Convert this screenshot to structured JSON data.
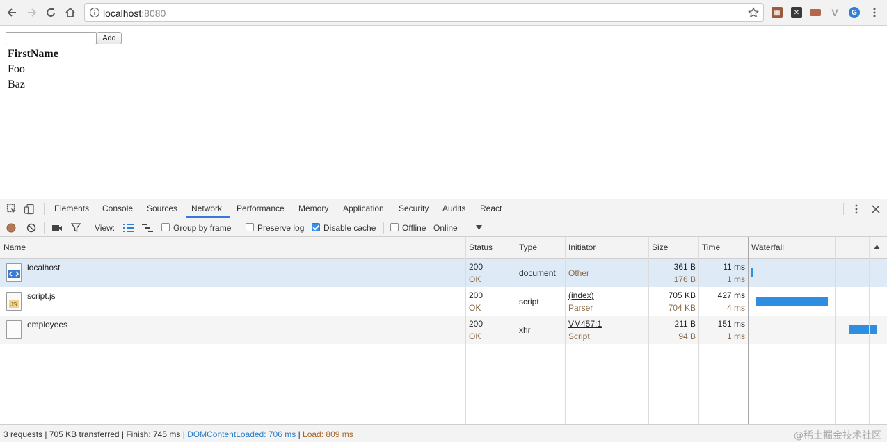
{
  "browser": {
    "url_host": "localhost",
    "url_port": ":8080"
  },
  "page": {
    "add_button": "Add",
    "input_value": "",
    "table_header": "FirstName",
    "rows": [
      "Foo",
      "Baz"
    ]
  },
  "devtools": {
    "tabs": [
      "Elements",
      "Console",
      "Sources",
      "Network",
      "Performance",
      "Memory",
      "Application",
      "Security",
      "Audits",
      "React"
    ],
    "active_tab": "Network",
    "toolbar": {
      "view_label": "View:",
      "group_by_frame": "Group by frame",
      "preserve_log": "Preserve log",
      "disable_cache": "Disable cache",
      "offline": "Offline",
      "throttle": "Online"
    },
    "columns": {
      "name": "Name",
      "status": "Status",
      "type": "Type",
      "initiator": "Initiator",
      "size": "Size",
      "time": "Time",
      "waterfall": "Waterfall"
    },
    "requests": [
      {
        "name": "localhost",
        "status": "200",
        "status_text": "OK",
        "type": "document",
        "initiator": "",
        "initiator_sub": "Other",
        "size": "361 B",
        "size_sub": "176 B",
        "time": "11 ms",
        "time_sub": "1 ms"
      },
      {
        "name": "script.js",
        "status": "200",
        "status_text": "OK",
        "type": "script",
        "initiator": "(index)",
        "initiator_sub": "Parser",
        "size": "705 KB",
        "size_sub": "704 KB",
        "time": "427 ms",
        "time_sub": "4 ms"
      },
      {
        "name": "employees",
        "status": "200",
        "status_text": "OK",
        "type": "xhr",
        "initiator": "VM457:1",
        "initiator_sub": "Script",
        "size": "211 B",
        "size_sub": "94 B",
        "time": "151 ms",
        "time_sub": "1 ms"
      }
    ],
    "status_bar": {
      "summary": "3 requests | 705 KB transferred | Finish: 745 ms | ",
      "dom_content_loaded": "DOMContentLoaded: 706 ms",
      "separator": " | ",
      "load": "Load: 809 ms"
    },
    "watermark": "@稀土掘金技术社区"
  },
  "colors": {
    "accent": "#3879d9",
    "waterfall_bar": "#2e8ee1",
    "selected_row": "#dfeaf7"
  }
}
